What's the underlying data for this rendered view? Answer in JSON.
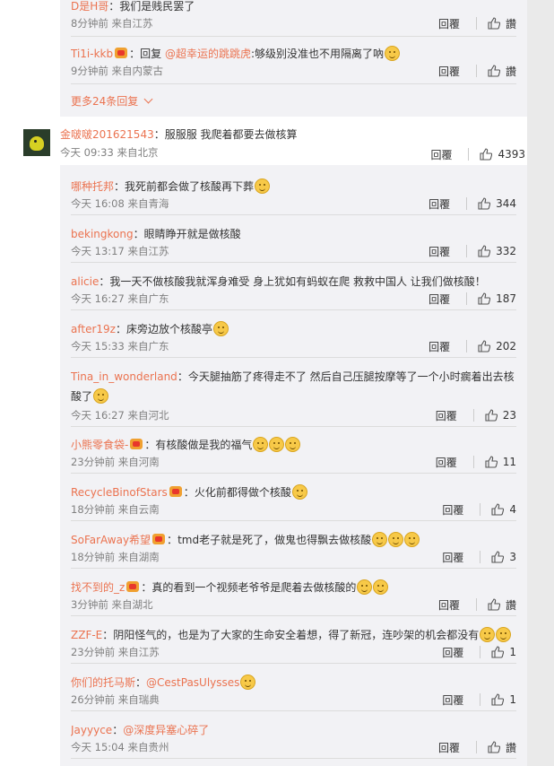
{
  "top_partial": {
    "user": "D是H哥",
    "text": "我们是贱民罢了",
    "time": "8分钟前",
    "loc": "来自江苏",
    "reply": "回覆",
    "like": "讚"
  },
  "top_reply2": {
    "user": "Ti1i-kkb",
    "text_prefix": "回复",
    "mention": "@超幸运的跳跳虎",
    "text": ":够级别没准也不用隔离了吶",
    "time": "9分钟前",
    "loc": "来自内蒙古",
    "reply": "回覆",
    "like": "讚"
  },
  "more_replies": "更多24条回复",
  "main_comment": {
    "user": "金啵啵201621543",
    "text": "服服服 我爬着都要去做核算",
    "time": "今天 09:33",
    "loc": "来自北京",
    "reply": "回覆",
    "likes": "4393"
  },
  "replies": [
    {
      "user": "哪种托邦",
      "text": "我死前都会做了核酸再下葬",
      "time": "今天 16:08",
      "loc": "来自青海",
      "reply": "回覆",
      "likes": "344"
    },
    {
      "user": "bekingkong",
      "text": "眼睛睁开就是做核酸",
      "time": "今天 13:17",
      "loc": "来自江苏",
      "reply": "回覆",
      "likes": "332"
    },
    {
      "user": "alicie",
      "text": "我一天不做核酸我就浑身难受 身上犹如有蚂蚁在爬 救救中国人 让我们做核酸！",
      "time": "今天 16:27",
      "loc": "来自广东",
      "reply": "回覆",
      "likes": "187"
    },
    {
      "user": "after19z",
      "text": "床旁边放个核酸亭",
      "time": "今天 15:33",
      "loc": "来自广东",
      "reply": "回覆",
      "likes": "202"
    },
    {
      "user": "Tina_in_wonderland",
      "text": "今天腿抽筋了疼得走不了 然后自己压腿按摩等了一个小时瘸着出去核酸了",
      "time": "今天 16:27",
      "loc": "来自河北",
      "reply": "回覆",
      "likes": "23"
    },
    {
      "user": "小熊零食袋-",
      "text": "有核酸做是我的福气",
      "time": "23分钟前",
      "loc": "来自河南",
      "reply": "回覆",
      "likes": "11"
    },
    {
      "user": "RecycleBinofStars",
      "text": "火化前都得做个核酸",
      "time": "18分钟前",
      "loc": "来自云南",
      "reply": "回覆",
      "likes": "4"
    },
    {
      "user": "SoFarAway希望",
      "text": "tmd老子就是死了，做鬼也得飘去做核酸",
      "time": "18分钟前",
      "loc": "来自湖南",
      "reply": "回覆",
      "likes": "3"
    },
    {
      "user": "找不到的_z",
      "text": "真的看到一个视频老爷爷是爬着去做核酸的",
      "time": "3分钟前",
      "loc": "来自湖北",
      "reply": "回覆",
      "likes": "讚"
    },
    {
      "user": "ZZF-E",
      "text": "阴阳怪气的，也是为了大家的生命安全着想，得了新冠，连吵架的机会都没有",
      "time": "23分钟前",
      "loc": "来自江苏",
      "reply": "回覆",
      "likes": "1"
    },
    {
      "user": "你们的托马斯",
      "text": "@CestPasUlysses",
      "time": "26分钟前",
      "loc": "来自瑞典",
      "reply": "回覆",
      "likes": "1"
    },
    {
      "user": "Jayyyce",
      "text": "@深度异塞心碎了",
      "time": "今天 15:04",
      "loc": "来自贵州",
      "reply": "回覆",
      "likes": "讚"
    }
  ],
  "colors": {
    "username": "#eb7350",
    "meta": "#808080",
    "reply_bg": "#f2f2f5",
    "page_bg": "#eaeaea"
  }
}
